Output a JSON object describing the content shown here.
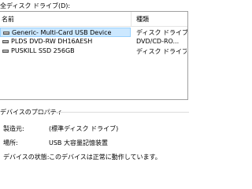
{
  "device_list": {
    "title": "全ディスク ドライブ(D):",
    "columns": {
      "name": "名前",
      "type": "種類"
    },
    "items": [
      {
        "name": "Generic- Multi-Card USB Device",
        "type": "ディスク ドライブ",
        "icon": "drive-icon",
        "selected": true
      },
      {
        "name": "PLDS DVD-RW DH16AESH",
        "type": "DVD/CD-RO...",
        "icon": "drive-icon",
        "selected": false
      },
      {
        "name": "PUSKILL SSD 256GB",
        "type": "ディスク ドライブ",
        "icon": "drive-icon",
        "selected": false
      }
    ]
  },
  "properties": {
    "title": "デバイスのプロパティ",
    "manufacturer": {
      "label": "製造元:",
      "value": "(標準ディスク ドライブ)"
    },
    "location": {
      "label": "場所:",
      "value": "USB 大容量記憶装置"
    },
    "status": {
      "label": "デバイスの状態:",
      "value": "このデバイスは正常に動作しています。"
    }
  }
}
